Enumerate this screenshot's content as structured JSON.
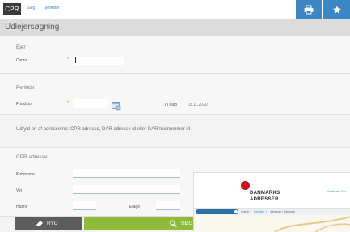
{
  "header": {
    "logo": "CPR",
    "nav": [
      "Søg",
      "Tjenester"
    ],
    "print_icon": "print-icon",
    "favorite_icon": "star-icon",
    "accent": "#3b87c4"
  },
  "page": {
    "title": "Udlejersøgning"
  },
  "owner": {
    "section_title": "Ejer",
    "cvr_label": "Cvr.nr",
    "cvr_value": ""
  },
  "period": {
    "section_title": "Periode",
    "from_label": "Fra dato",
    "from_value": "",
    "calendar_icon": "calendar-icon",
    "to_label": "Til dato",
    "to_value": "03.11.2020"
  },
  "hint": "Udfyld en af adresserne: CPR adresse, DAR adresse id eller DAR husnummer id",
  "cpr_address": {
    "section_title": "CPR adresse",
    "kommune_label": "Kommune",
    "vej_label": "Vej",
    "husnr_label": "Husnr",
    "etage_label": "Etage"
  },
  "actions": {
    "clear_label": "RYD",
    "search_label": "SØG",
    "clear_icon": "eraser-icon",
    "search_icon": "search-icon",
    "search_color": "#8fba3a",
    "clear_color": "#5d5d5d"
  },
  "overlay": {
    "brand_line1": "DANMARKS",
    "brand_line2": "ADRESSER",
    "top_link": "Adresser i Dan",
    "crumb_1": "Guider",
    "crumb_sep": "/",
    "crumb_2": "Forside",
    "crumb_3": "Adresser i Danmark"
  }
}
